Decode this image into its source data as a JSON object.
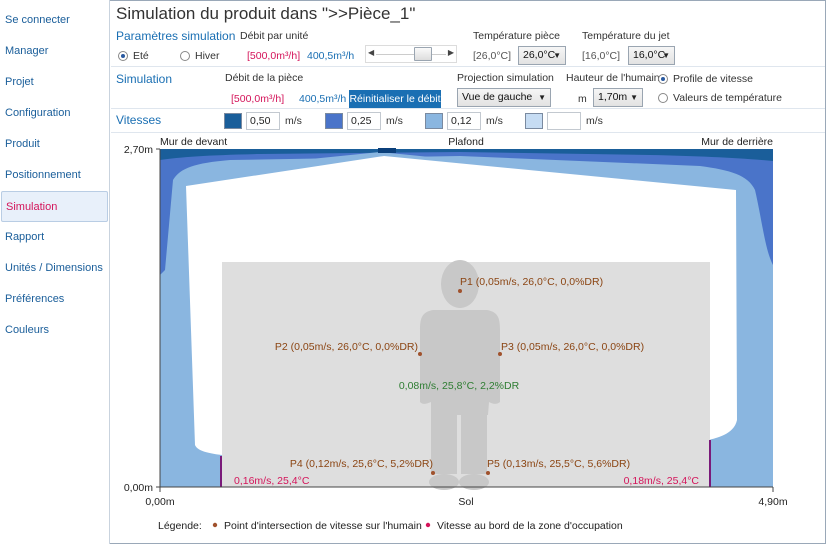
{
  "sidebar": {
    "items": [
      {
        "label": "Se connecter",
        "active": false
      },
      {
        "label": "Manager",
        "active": false
      },
      {
        "label": "Projet",
        "active": false
      },
      {
        "label": "Configuration",
        "active": false
      },
      {
        "label": "Produit",
        "active": false
      },
      {
        "label": "Positionnement",
        "active": false
      },
      {
        "label": "Simulation",
        "active": true
      },
      {
        "label": "Rapport",
        "active": false
      },
      {
        "label": "Unités / Dimensions",
        "active": false
      },
      {
        "label": "Préférences",
        "active": false
      },
      {
        "label": "Couleurs",
        "active": false
      }
    ]
  },
  "header": {
    "title": "Simulation du produit dans \">>Pièce_1\""
  },
  "params": {
    "section_title": "Paramètres simulation",
    "season_ete": "Eté",
    "season_hiver": "Hiver",
    "season_selected": "Eté",
    "debit_label": "Débit par unité",
    "debit_max": "[500,0m³/h]",
    "debit_value": "400,5m³/h",
    "temp_piece_label": "Température pièce",
    "temp_piece_ref": "[26,0°C]",
    "temp_piece_value": "26,0°C",
    "temp_jet_label": "Température du jet",
    "temp_jet_ref": "[16,0°C]",
    "temp_jet_value": "16,0°C"
  },
  "simulation": {
    "section_title": "Simulation",
    "debit_piece_label": "Débit de la pièce",
    "debit_piece_max": "[500,0m³/h]",
    "debit_piece_value": "400,5m³/h",
    "reset_button": "Réinitialiser le débit",
    "projection_label": "Projection simulation",
    "projection_value": "Vue de gauche",
    "hauteur_label": "Hauteur de l'humain",
    "hauteur_unit": "m",
    "hauteur_value": "1,70m",
    "profile_vitesse": "Profile de vitesse",
    "valeurs_temp": "Valeurs de température",
    "profile_selected": "Profile de vitesse"
  },
  "vitesses": {
    "section_title": "Vitesses",
    "unit": "m/s",
    "items": [
      {
        "value": "0,50",
        "color": "#1a5e9a"
      },
      {
        "value": "0,25",
        "color": "#4a74c9"
      },
      {
        "value": "0,12",
        "color": "#8ab6e0"
      },
      {
        "value": "",
        "color": "#c6dcf3"
      }
    ]
  },
  "chart": {
    "label_front": "Mur de devant",
    "label_ceiling": "Plafond",
    "label_back": "Mur de derrière",
    "label_floor": "Sol",
    "y_top": "2,70m",
    "y_bottom": "0,00m",
    "x_left": "0,00m",
    "x_right": "4,90m",
    "points": [
      {
        "name": "P1",
        "text": "P1 (0,05m/s, 26,0°C, 0,0%DR)"
      },
      {
        "name": "P2",
        "text": "P2 (0,05m/s, 26,0°C, 0,0%DR)"
      },
      {
        "name": "P3",
        "text": "P3 (0,05m/s, 26,0°C, 0,0%DR)"
      },
      {
        "name": "P4",
        "text": "P4 (0,12m/s, 25,6°C, 5,2%DR)"
      },
      {
        "name": "P5",
        "text": "P5 (0,13m/s, 25,5°C, 5,6%DR)"
      }
    ],
    "center_value": "0,08m/s, 25,8°C, 2,2%DR",
    "edge_left": "0,16m/s, 25,4°C",
    "edge_right": "0,18m/s, 25,4°C",
    "colors": {
      "dark": "#1a5e9a",
      "mid": "#4a74c9",
      "light": "#8ab6e0",
      "zone": "#dedede",
      "human": "#c8c8c8",
      "point_orange": "#a0522d",
      "edge_pink": "#d4145a",
      "center_green": "#2e7d32"
    }
  },
  "legend": {
    "label": "Légende:",
    "intersection": "Point d'intersection de vitesse sur l'humain",
    "edge": "Vitesse au bord de la zone d'occupation"
  }
}
